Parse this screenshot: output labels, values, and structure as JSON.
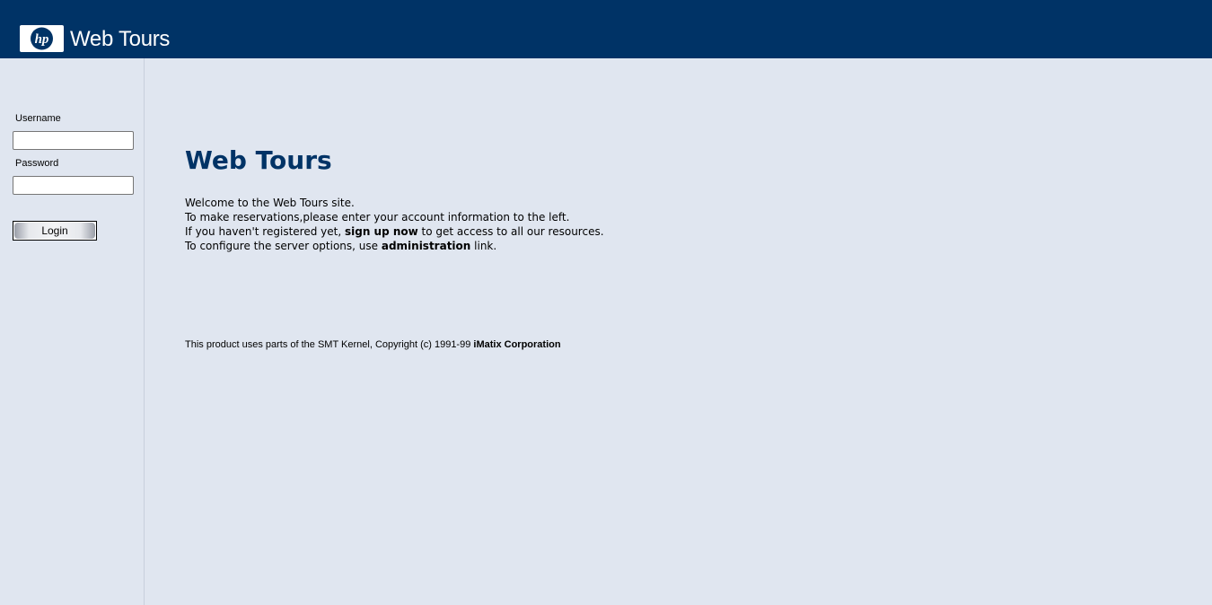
{
  "header": {
    "logo_mark": "hp",
    "logo_icon": "hp-logo-icon",
    "app_title": "Web Tours",
    "background_color": "#003366"
  },
  "sidebar": {
    "username_label": "Username",
    "username_value": "",
    "password_label": "Password",
    "password_value": "",
    "login_button_label": "Login"
  },
  "main": {
    "title": "Web Tours",
    "title_color": "#003366",
    "welcome_line1": "Welcome to the Web Tours site.",
    "welcome_line2": "To make reservations,please enter your account information to the left.",
    "welcome_line3_prefix": "If you haven't registered yet, ",
    "signup_link": "sign up now",
    "welcome_line3_suffix": " to get access to all our resources.",
    "welcome_line4_prefix": "To configure the server options, use ",
    "admin_link": "administration",
    "welcome_line4_suffix": " link.",
    "footer_prefix": "This product uses parts of the SMT Kernel, Copyright (c) 1991-99 ",
    "footer_link": "iMatix Corporation"
  },
  "colors": {
    "page_background": "#e0e6f0",
    "accent": "#003366"
  }
}
